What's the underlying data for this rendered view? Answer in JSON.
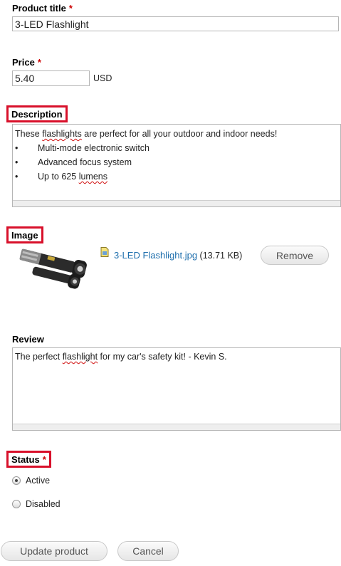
{
  "form": {
    "title": {
      "label": "Product title",
      "required": "*",
      "value": "3-LED Flashlight"
    },
    "price": {
      "label": "Price",
      "required": "*",
      "value": "5.40",
      "currency": "USD"
    },
    "description": {
      "label": "Description",
      "intro_before": "These ",
      "intro_misspelled": "flashlights",
      "intro_after": " are perfect for all your outdoor and indoor needs!",
      "bullet": "•",
      "bullets": [
        "Multi-mode electronic switch",
        "Advanced focus system"
      ],
      "last_bullet_before": "Up to 625 ",
      "last_bullet_misspelled": "lumens"
    },
    "image": {
      "label": "Image",
      "file_name": "3-LED Flashlight.jpg",
      "file_size": "(13.71 KB)",
      "remove_label": "Remove",
      "file_icon": "image-file-icon",
      "thumbnail": "flashlight-thumbnail"
    },
    "review": {
      "label": "Review",
      "text_before": "The perfect ",
      "text_misspelled": "flashlight",
      "text_after": " for my car's safety kit! - Kevin S."
    },
    "status": {
      "label": "Status",
      "required": "*",
      "options": [
        "Active",
        "Disabled"
      ],
      "selected": "Active"
    },
    "actions": {
      "update_label": "Update product",
      "cancel_label": "Cancel"
    }
  },
  "colors": {
    "highlight": "#d8102a",
    "required": "#cc0000",
    "link": "#1f6fad"
  }
}
